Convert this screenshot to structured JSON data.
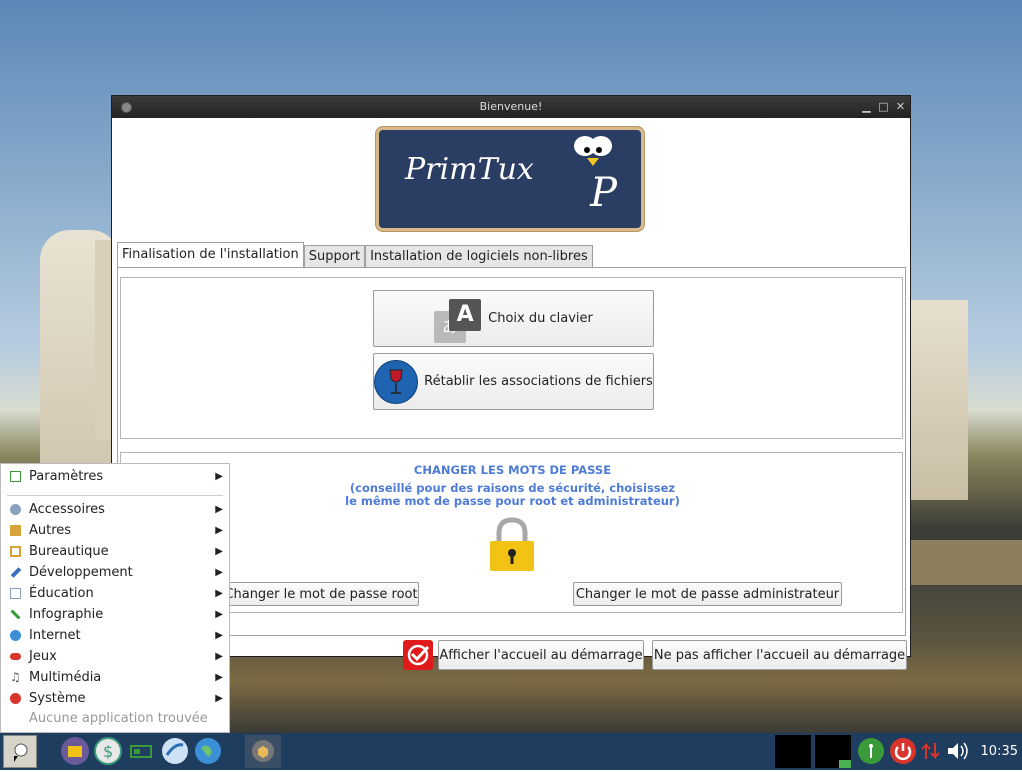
{
  "window": {
    "title": "Bienvenue!",
    "logo_text": "PrimTux",
    "logo_letter": "P"
  },
  "tabs": [
    {
      "label": "Finalisation de l'installation",
      "active": true
    },
    {
      "label": "Support",
      "active": false
    },
    {
      "label": "Installation de logiciels non-libres",
      "active": false
    }
  ],
  "buttons": {
    "keyboard": "Choix du clavier",
    "keyboard_icon_front": "A",
    "keyboard_icon_back": "あ",
    "associations": "Rétablir les associations de fichiers",
    "root_password": "Changer le mot de passe root",
    "admin_password": "Changer le mot de passe administrateur",
    "show_welcome": "Afficher l'accueil au démarrage",
    "hide_welcome": "Ne pas afficher l'accueil au démarrage"
  },
  "password_section": {
    "title": "CHANGER LES MOTS DE PASSE",
    "subtitle_line1": "(conseillé pour des raisons de sécurité, choisissez",
    "subtitle_line2": "le même mot de passe pour root et administrateur)"
  },
  "app_menu": {
    "items": [
      {
        "label": "Paramètres",
        "icon": "settings-icon",
        "color": "#3a9a3a"
      },
      {
        "label": "Accessoires",
        "icon": "accessories-icon",
        "color": "#8aa0c0"
      },
      {
        "label": "Autres",
        "icon": "other-icon",
        "color": "#d9a23a"
      },
      {
        "label": "Bureautique",
        "icon": "office-icon",
        "color": "#d9a23a"
      },
      {
        "label": "Développement",
        "icon": "wrench-icon",
        "color": "#3b6fc1"
      },
      {
        "label": "Éducation",
        "icon": "education-icon",
        "color": "#8aa0c0"
      },
      {
        "label": "Infographie",
        "icon": "graphics-icon",
        "color": "#3a9a3a"
      },
      {
        "label": "Internet",
        "icon": "globe-icon",
        "color": "#3b8fd6"
      },
      {
        "label": "Jeux",
        "icon": "gamepad-icon",
        "color": "#d9342b"
      },
      {
        "label": "Multimédia",
        "icon": "music-icon",
        "color": "#555555"
      },
      {
        "label": "Système",
        "icon": "system-icon",
        "color": "#d9342b"
      }
    ],
    "empty_label": "Aucune application trouvée"
  },
  "taskbar": {
    "clock": "10:35",
    "accent": "#1f3d5e"
  }
}
